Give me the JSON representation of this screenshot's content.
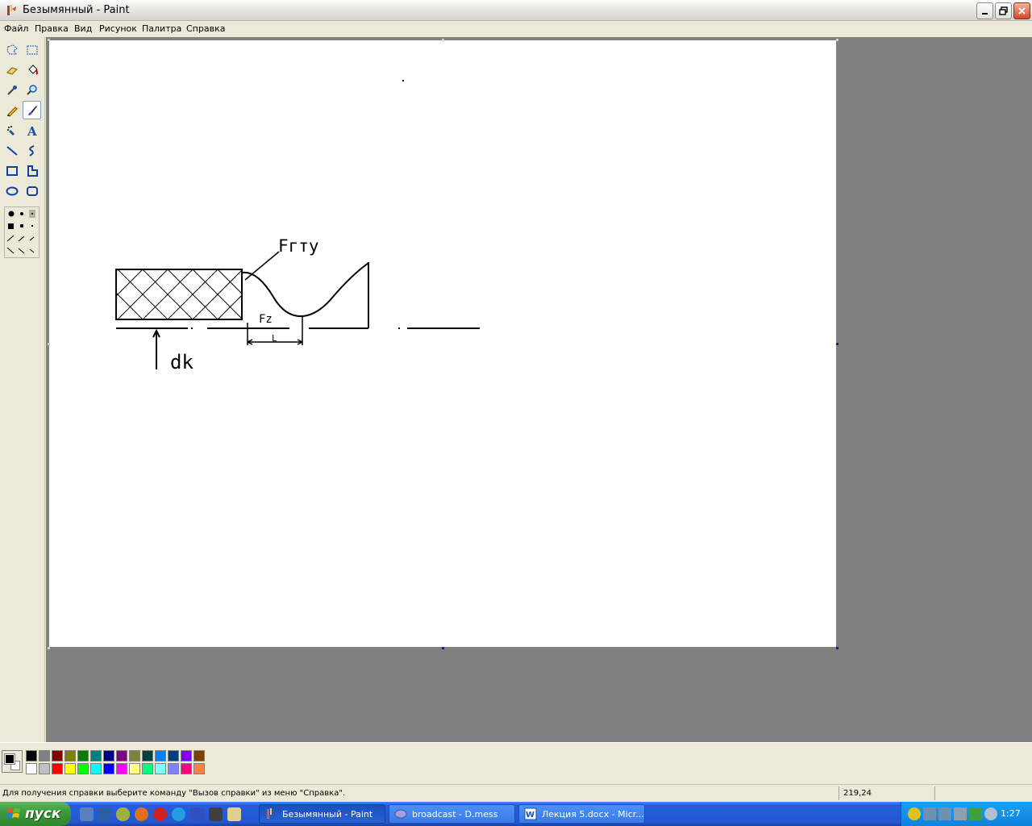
{
  "window": {
    "title": "Безымянный - Paint"
  },
  "menu": {
    "items": [
      "Файл",
      "Правка",
      "Вид",
      "Рисунок",
      "Палитра",
      "Справка"
    ]
  },
  "drawing": {
    "label_frtu": "Fгту",
    "label_fz": "Fz",
    "label_l": "L",
    "label_dk": "dk"
  },
  "palette": {
    "top": [
      "#000000",
      "#808080",
      "#800000",
      "#808000",
      "#008000",
      "#008080",
      "#000080",
      "#800080",
      "#808040",
      "#004040",
      "#0080ff",
      "#004080",
      "#8000ff",
      "#804000"
    ],
    "bottom": [
      "#ffffff",
      "#c0c0c0",
      "#ff0000",
      "#ffff00",
      "#00ff00",
      "#00ffff",
      "#0000ff",
      "#ff00ff",
      "#ffff80",
      "#00ff80",
      "#80ffff",
      "#8080ff",
      "#ff0080",
      "#ff8040"
    ]
  },
  "status": {
    "help": "Для получения справки выберите команду \"Вызов справки\" из меню \"Справка\".",
    "coords": "219,24"
  },
  "taskbar": {
    "start": "пуск",
    "tasks": [
      "Безымянный - Paint",
      "broadcast - D.mess",
      "Лекция 5.docx - Micr..."
    ],
    "clock": "1:27"
  }
}
